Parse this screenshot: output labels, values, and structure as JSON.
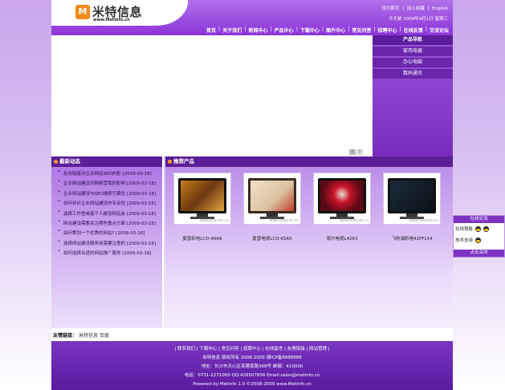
{
  "header": {
    "logo_badge": "M",
    "logo_cn": "米特信息",
    "logo_en": "www.MetInfo.cn",
    "top_links": [
      "设为首页",
      "|",
      "加入收藏",
      "|",
      "English"
    ],
    "date": "今天是 2009年4月1日 星期三",
    "nav": [
      "首页",
      "关于我们",
      "新闻中心",
      "产品中心",
      "下载中心",
      "图片中心",
      "常见问答",
      "招聘中心",
      "在线反馈",
      "交流论坛"
    ]
  },
  "banner": {
    "dots": [
      "1",
      "2"
    ]
  },
  "product_nav": {
    "title": "产品导航",
    "items": [
      "家用电器",
      "办公电脑",
      "数码通讯"
    ]
  },
  "news": {
    "title": "最新动态",
    "items": [
      "反向链接对企业网站SEO的影 [2009-03-18]",
      "企业网站建设对网络营销的影响 [2009-03-18]",
      "企业网站建设与SEO搜索引擎优 [2009-03-18]",
      "如何评价企业网站建设的专业性 [2009-03-18]",
      "选择工作室或者个人建设网站会 [2009-03-18]",
      "网站建设需要关注哪些重点方面 [2009-03-18]",
      "如何策划一个优秀的网站? [2009-03-18]",
      "选择网站建设服务商需要注意的 [2009-03-18]",
      "如何选择合适的网站推广服务 [2009-03-18]"
    ]
  },
  "products": {
    "title": "推荐产品",
    "items": [
      {
        "name": "夏普彩电LCD-46A6",
        "watermark": "www.metinfo.cn"
      },
      {
        "name": "夏普电视LCD-65A5",
        "watermark": "www.metinfo.cn"
      },
      {
        "name": "海尔电视L42K3",
        "watermark": "www.metinfo.cn"
      },
      {
        "name": "飞利浦彩电42PFL54",
        "watermark": "www.metinfo.cn"
      }
    ]
  },
  "links": {
    "label": "友情链接：",
    "items": [
      "米特信息",
      "百度"
    ]
  },
  "footer": {
    "links_row": "| 联系我们 | 下载中心 | 常见问答 | 招聘中心 | 在线留言 | 友情链接 | 网站管理 |",
    "copyright": "米特信息 版权所有 2008-2009 湘ICP备8888888",
    "address": "地址：长沙市天心区芙蓉南路368号 邮编：410000",
    "contact": "电话：0731-2271060 QQ:426507856 Email:sales@metinfo.cn",
    "powered": "Powered by MetInfo 1.0 ©2008-2009 www.MetInfo.cn"
  },
  "service": {
    "title": "在线交流",
    "rows": [
      "在线销售",
      "技术支持"
    ],
    "close": "点击关闭"
  },
  "colors": {
    "accent": "#8c35d8",
    "dark": "#5b1e96",
    "orange": "#f28a1a"
  }
}
